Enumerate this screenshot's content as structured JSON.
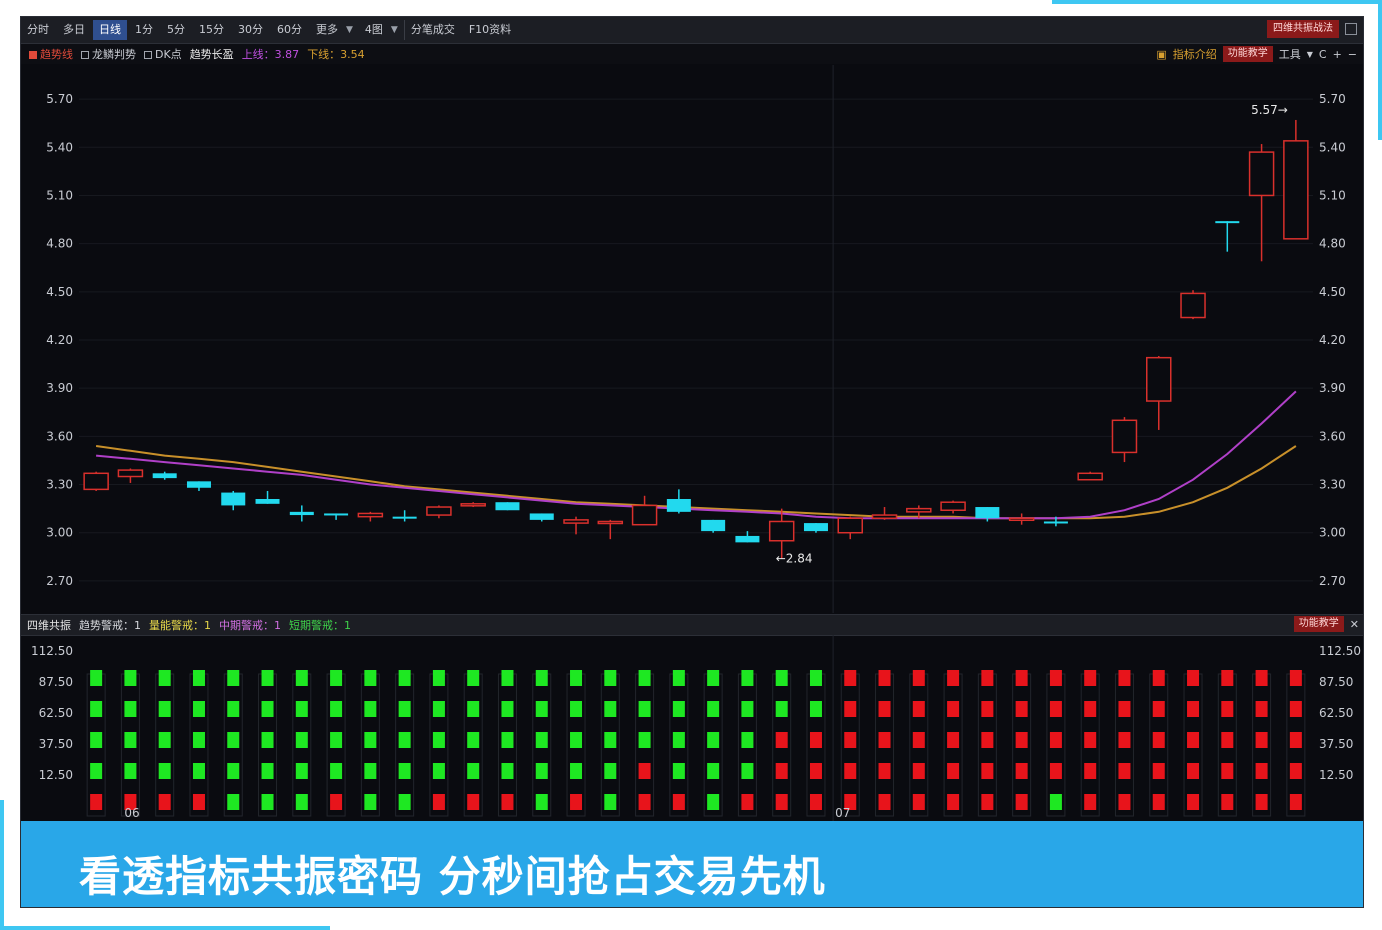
{
  "toolbar": {
    "tabs": [
      "分时",
      "多日",
      "日线",
      "1分",
      "5分",
      "15分",
      "30分",
      "60分",
      "更多",
      "4图",
      "分笔成交",
      "F10资料"
    ],
    "active_tab": "日线",
    "right_button": "四维共振战法"
  },
  "legend": {
    "items": [
      {
        "label": "趋势线",
        "color": "#e04a3a",
        "checked": true
      },
      {
        "label": "龙鳞判势",
        "color": "#c9ccd3",
        "checked": false
      },
      {
        "label": "DK点",
        "color": "#c9ccd3",
        "checked": false
      }
    ],
    "trend_label": "趋势长盈",
    "upper_text": "上线：3.87",
    "lower_text": "下线：3.54",
    "indicator_intro": "指标介绍",
    "func_teach": "功能教学",
    "tools": "工具",
    "c_icon": "C",
    "plus": "+",
    "minus": "−"
  },
  "subpanel": {
    "title": "四维共振",
    "items": [
      {
        "text": "趋势警戒：1",
        "color": "#d6d8dc"
      },
      {
        "text": "量能警戒：1",
        "color": "#e8d84a"
      },
      {
        "text": "中期警戒：1",
        "color": "#d070e0"
      },
      {
        "text": "短期警戒：1",
        "color": "#3fd14a"
      }
    ],
    "func_teach": "功能教学",
    "close": "✕",
    "yticks": [
      "112.50",
      "87.50",
      "62.50",
      "37.50",
      "12.50"
    ],
    "grid": [
      "GGGGR",
      "GGGGR",
      "GGGGR",
      "GGGGR",
      "GGGGG",
      "GGGGG",
      "GGGGG",
      "GGGGR",
      "GGGGG",
      "GGGGG",
      "GGGGR",
      "GGGGR",
      "GGGGR",
      "GGGGG",
      "GGGGR",
      "GGGGG",
      "GGGRR",
      "GGGGR",
      "GGGGG",
      "GGGGR",
      "GGRRR",
      "GGRRR",
      "RRRRR",
      "RRRRR",
      "RRRRR",
      "RRRRR",
      "RRRRR",
      "RRRRR",
      "RRRRG",
      "RRRRR",
      "RRRRR",
      "RRRRR",
      "RRRRR",
      "RRRRR",
      "RRRRR",
      "RRRRR"
    ]
  },
  "x_labels": {
    "left": "06",
    "mid": "07"
  },
  "banner": {
    "text": "看透指标共振密码   分秒间抢占交易先机"
  },
  "colors": {
    "up": "#d9302c",
    "down": "#22d9ee",
    "ma_fast": "#b040c8",
    "ma_slow": "#c8902a",
    "green_block": "#1ee822",
    "red_block": "#e8141b"
  },
  "chart_data": {
    "type": "candlestick",
    "ylim": [
      2.55,
      5.85
    ],
    "y_ticks": [
      "5.70",
      "5.40",
      "5.10",
      "4.80",
      "4.50",
      "4.20",
      "3.90",
      "3.60",
      "3.30",
      "3.00",
      "2.70"
    ],
    "candles": [
      {
        "o": 3.27,
        "c": 3.37,
        "h": 3.38,
        "l": 3.26
      },
      {
        "o": 3.35,
        "c": 3.39,
        "h": 3.4,
        "l": 3.31
      },
      {
        "o": 3.37,
        "c": 3.34,
        "h": 3.38,
        "l": 3.33
      },
      {
        "o": 3.32,
        "c": 3.28,
        "h": 3.32,
        "l": 3.26
      },
      {
        "o": 3.25,
        "c": 3.17,
        "h": 3.26,
        "l": 3.14
      },
      {
        "o": 3.21,
        "c": 3.18,
        "h": 3.26,
        "l": 3.18
      },
      {
        "o": 3.13,
        "c": 3.11,
        "h": 3.17,
        "l": 3.07
      },
      {
        "o": 3.12,
        "c": 3.11,
        "h": 3.12,
        "l": 3.08
      },
      {
        "o": 3.1,
        "c": 3.12,
        "h": 3.13,
        "l": 3.07
      },
      {
        "o": 3.1,
        "c": 3.09,
        "h": 3.14,
        "l": 3.07
      },
      {
        "o": 3.11,
        "c": 3.16,
        "h": 3.17,
        "l": 3.09
      },
      {
        "o": 3.17,
        "c": 3.18,
        "h": 3.19,
        "l": 3.16
      },
      {
        "o": 3.19,
        "c": 3.14,
        "h": 3.19,
        "l": 3.14
      },
      {
        "o": 3.12,
        "c": 3.08,
        "h": 3.12,
        "l": 3.07
      },
      {
        "o": 3.06,
        "c": 3.08,
        "h": 3.1,
        "l": 2.99
      },
      {
        "o": 3.06,
        "c": 3.07,
        "h": 3.08,
        "l": 2.96
      },
      {
        "o": 3.05,
        "c": 3.17,
        "h": 3.23,
        "l": 3.05
      },
      {
        "o": 3.21,
        "c": 3.13,
        "h": 3.27,
        "l": 3.12
      },
      {
        "o": 3.08,
        "c": 3.01,
        "h": 3.08,
        "l": 3.0
      },
      {
        "o": 2.98,
        "c": 2.94,
        "h": 3.01,
        "l": 2.94
      },
      {
        "o": 2.95,
        "c": 3.07,
        "h": 3.15,
        "l": 2.84
      },
      {
        "o": 3.06,
        "c": 3.01,
        "h": 3.06,
        "l": 3.0
      },
      {
        "o": 3.0,
        "c": 3.09,
        "h": 3.1,
        "l": 2.96
      },
      {
        "o": 3.09,
        "c": 3.11,
        "h": 3.16,
        "l": 3.08
      },
      {
        "o": 3.13,
        "c": 3.15,
        "h": 3.17,
        "l": 3.09
      },
      {
        "o": 3.14,
        "c": 3.19,
        "h": 3.2,
        "l": 3.12
      },
      {
        "o": 3.16,
        "c": 3.09,
        "h": 3.16,
        "l": 3.07
      },
      {
        "o": 3.08,
        "c": 3.09,
        "h": 3.12,
        "l": 3.05
      },
      {
        "o": 3.07,
        "c": 3.06,
        "h": 3.1,
        "l": 3.04
      },
      {
        "o": 3.33,
        "c": 3.37,
        "h": 3.38,
        "l": 3.33
      },
      {
        "o": 3.5,
        "c": 3.7,
        "h": 3.72,
        "l": 3.44
      },
      {
        "o": 3.82,
        "c": 4.09,
        "h": 4.1,
        "l": 3.64
      },
      {
        "o": 4.34,
        "c": 4.49,
        "h": 4.51,
        "l": 4.33
      },
      {
        "o": 4.94,
        "c": 4.93,
        "h": 4.94,
        "l": 4.75
      },
      {
        "o": 5.1,
        "c": 5.37,
        "h": 5.42,
        "l": 4.69
      },
      {
        "o": 4.83,
        "c": 5.44,
        "h": 5.57,
        "l": 4.83
      }
    ],
    "ma_fast": [
      3.48,
      3.46,
      3.44,
      3.42,
      3.4,
      3.38,
      3.36,
      3.33,
      3.3,
      3.28,
      3.26,
      3.24,
      3.22,
      3.2,
      3.18,
      3.17,
      3.16,
      3.15,
      3.14,
      3.13,
      3.12,
      3.1,
      3.09,
      3.09,
      3.09,
      3.09,
      3.09,
      3.09,
      3.09,
      3.1,
      3.14,
      3.21,
      3.33,
      3.49,
      3.68,
      3.88
    ],
    "ma_slow": [
      3.54,
      3.51,
      3.48,
      3.46,
      3.44,
      3.41,
      3.38,
      3.35,
      3.32,
      3.29,
      3.27,
      3.25,
      3.23,
      3.21,
      3.19,
      3.18,
      3.17,
      3.16,
      3.15,
      3.14,
      3.13,
      3.12,
      3.11,
      3.1,
      3.1,
      3.1,
      3.09,
      3.09,
      3.09,
      3.09,
      3.1,
      3.13,
      3.19,
      3.28,
      3.4,
      3.54
    ],
    "annotations": [
      {
        "label": "←2.84"
      },
      {
        "label": "5.57→"
      }
    ]
  }
}
